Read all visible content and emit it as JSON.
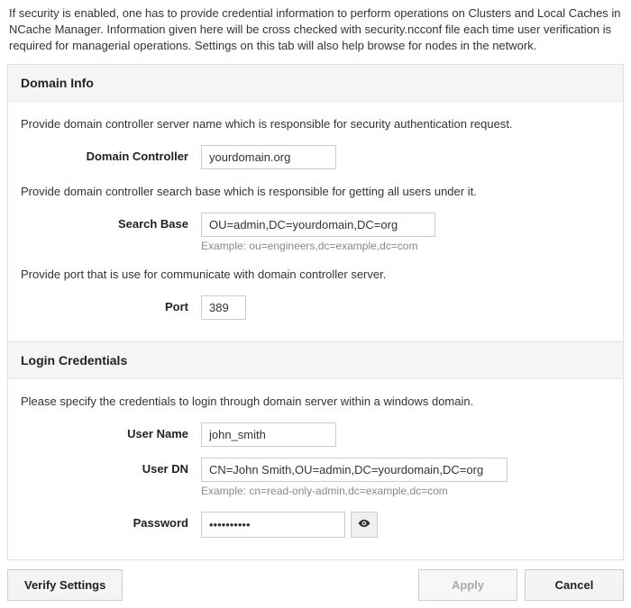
{
  "intro": "If security is enabled, one has to provide credential information to perform operations on Clusters and Local Caches in NCache Manager. Information given here will be cross checked with security.ncconf file each time user verification is required for managerial operations. Settings on this tab will also help browse for nodes in the network.",
  "domain_info": {
    "title": "Domain Info",
    "desc_controller": "Provide domain controller server name which is responsible for security authentication request.",
    "label_controller": "Domain Controller",
    "value_controller": "yourdomain.org",
    "desc_search_base": "Provide domain controller search base which is responsible for getting all users under it.",
    "label_search_base": "Search Base",
    "value_search_base": "OU=admin,DC=yourdomain,DC=org",
    "example_search_base": "Example: ou=engineers,dc=example,dc=com",
    "desc_port": "Provide port that is use for communicate with domain controller server.",
    "label_port": "Port",
    "value_port": "389"
  },
  "login_credentials": {
    "title": "Login Credentials",
    "desc": "Please specify the credentials to login through domain server within a windows domain.",
    "label_username": "User Name",
    "value_username": "john_smith",
    "label_userdn": "User DN",
    "value_userdn": "CN=John Smith,OU=admin,DC=yourdomain,DC=org",
    "example_userdn": "Example: cn=read-only-admin,dc=example,dc=com",
    "label_password": "Password",
    "value_password": "••••••••••"
  },
  "footer": {
    "verify": "Verify Settings",
    "apply": "Apply",
    "cancel": "Cancel"
  }
}
